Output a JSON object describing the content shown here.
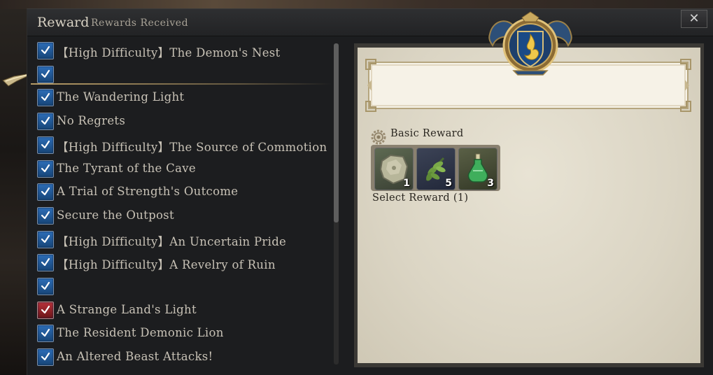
{
  "window": {
    "title": "Reward",
    "subtitle": "Rewards Received",
    "close_label": "✕"
  },
  "quests": [
    {
      "label": "【High Difficulty】The Demon's Nest",
      "checked": true,
      "color": "blue"
    },
    {
      "label": "",
      "checked": true,
      "color": "blue"
    },
    {
      "label": "The Wandering Light",
      "checked": true,
      "color": "blue"
    },
    {
      "label": "No Regrets",
      "checked": true,
      "color": "blue"
    },
    {
      "label": "【High Difficulty】The Source of Commotion",
      "checked": true,
      "color": "blue"
    },
    {
      "label": "The Tyrant of the Cave",
      "checked": true,
      "color": "blue"
    },
    {
      "label": "A Trial of Strength's Outcome",
      "checked": true,
      "color": "blue"
    },
    {
      "label": "Secure the Outpost",
      "checked": true,
      "color": "blue"
    },
    {
      "label": "【High Difficulty】An Uncertain Pride",
      "checked": true,
      "color": "blue"
    },
    {
      "label": "【High Difficulty】A Revelry of Ruin",
      "checked": true,
      "color": "blue"
    },
    {
      "label": "",
      "checked": true,
      "color": "blue"
    },
    {
      "label": "A Strange Land's Light",
      "checked": true,
      "color": "red"
    },
    {
      "label": "The Resident Demonic Lion",
      "checked": true,
      "color": "blue"
    },
    {
      "label": "An Altered Beast Attacks!",
      "checked": true,
      "color": "blue"
    }
  ],
  "reward_panel": {
    "basic_reward_label": "Basic Reward",
    "items": [
      {
        "icon": "ore-chunk-icon",
        "quantity": "1"
      },
      {
        "icon": "herb-leaf-icon",
        "quantity": "5"
      },
      {
        "icon": "potion-bottle-icon",
        "quantity": "3"
      }
    ],
    "select_reward_label": "Select Reward (1)"
  },
  "colors": {
    "check_blue": "#2d6eb8",
    "check_red": "#b8323a",
    "parchment": "#e3ddcc",
    "accent_gold": "#c8a86e"
  }
}
